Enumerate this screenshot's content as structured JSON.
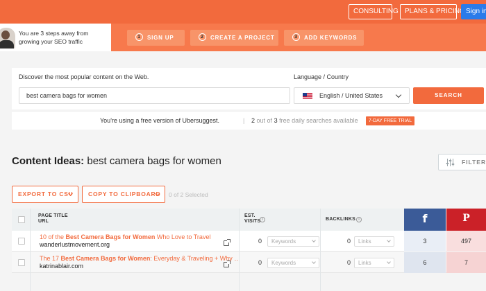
{
  "header": {
    "consulting_label": "CONSULTING",
    "plans_label": "PLANS & PRICING",
    "signin_label": "Sign in",
    "accent_color": "#f26a3d"
  },
  "steps": {
    "intro_line1": "You are 3 steps away from",
    "intro_line2": "growing your SEO traffic",
    "items": [
      {
        "num": "1",
        "label": "SIGN UP"
      },
      {
        "num": "2",
        "label": "CREATE A PROJECT"
      },
      {
        "num": "3",
        "label": "ADD KEYWORDS"
      }
    ]
  },
  "search": {
    "discover_label": "Discover the most popular content on the Web.",
    "keyword_value": "best camera bags for women",
    "language_label": "Language / Country",
    "language_value": "English / United States",
    "search_label": "SEARCH"
  },
  "notice": {
    "text": "You're using a free version of Ubersuggest.",
    "separator": "|",
    "used": "2",
    "out_of": "out of",
    "total": "3",
    "suffix": "free daily searches available",
    "trial_label": "7-DAY FREE TRIAL"
  },
  "content": {
    "title_bold": "Content Ideas:",
    "title_keyword": "best camera bags for women",
    "filter_label": "FILTER",
    "export_label": "EXPORT TO CSV",
    "copy_label": "COPY TO CLIPBOARD",
    "selected_text": "0 of 2 Selected"
  },
  "table": {
    "col_title_line1": "PAGE TITLE",
    "col_title_line2": "URL",
    "col_visits_line1": "EST.",
    "col_visits_line2": "VISITS",
    "col_backlinks": "BACKLINKS",
    "fb_icon": "f",
    "pin_icon": "P",
    "rows": [
      {
        "title_prefix": "10 of the ",
        "title_bold": "Best Camera Bags for Women",
        "title_suffix": " Who Love to Travel",
        "domain": "wanderlustmovement.org",
        "visits": "0",
        "keywords_label": "Keywords",
        "backlinks": "0",
        "links_label": "Links",
        "facebook": "3",
        "pinterest": "497"
      },
      {
        "title_prefix": "The 17 ",
        "title_bold": "Best Camera Bags for Women",
        "title_suffix": ": Everyday & Traveling + Why …",
        "domain": "katrinablair.com",
        "visits": "0",
        "keywords_label": "Keywords",
        "backlinks": "0",
        "links_label": "Links",
        "facebook": "6",
        "pinterest": "7"
      }
    ]
  }
}
